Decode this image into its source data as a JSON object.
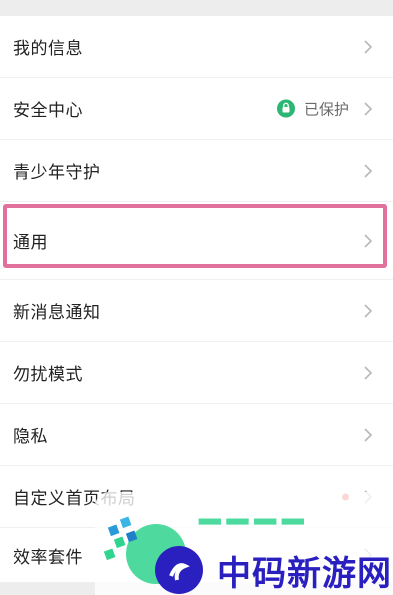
{
  "settings": {
    "items": [
      {
        "label": "我的信息"
      },
      {
        "label": "安全中心",
        "status": "已保护"
      },
      {
        "label": "青少年守护"
      },
      {
        "label": "通用"
      },
      {
        "label": "新消息通知"
      },
      {
        "label": "勿扰模式"
      },
      {
        "label": "隐私"
      },
      {
        "label": "自定义首页布局"
      },
      {
        "label": "效率套件"
      }
    ]
  },
  "watermark": {
    "brand": "中码新游网"
  },
  "colors": {
    "background": "#ededed",
    "highlight": "#e0709c",
    "status_green": "#2bb673",
    "watermark_blue": "#2a1fbf",
    "watermark_green": "#2fd48e"
  },
  "icons": {
    "chevron": "chevron-right-icon",
    "shield": "shield-icon",
    "watermark_logo": "logo-icon"
  }
}
